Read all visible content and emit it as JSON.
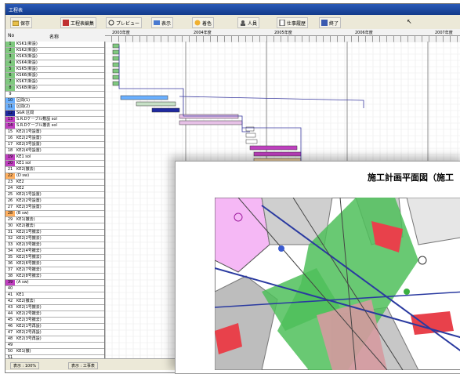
{
  "window": {
    "title": "工程表"
  },
  "toolbar": {
    "buttons": [
      {
        "label": "保存",
        "icon": "folder-icon"
      },
      {
        "label": "工程表編集",
        "icon": "edit-icon"
      },
      {
        "label": "プレビュー",
        "icon": "preview-icon"
      },
      {
        "label": "表示",
        "icon": "view-icon"
      },
      {
        "label": "着色",
        "icon": "paint-icon"
      },
      {
        "label": "人員",
        "icon": "people-icon"
      },
      {
        "label": "仕事履歴",
        "icon": "history-icon"
      },
      {
        "label": "終了",
        "icon": "exit-icon"
      }
    ]
  },
  "header": {
    "no_label": "No",
    "name_label": "名称",
    "years": [
      "2003年度",
      "2004年度",
      "2005年度",
      "2006年度",
      "2007年度"
    ]
  },
  "tasks": [
    {
      "no": "1",
      "name": "KSK1(新設)",
      "color": "#7fc97f"
    },
    {
      "no": "2",
      "name": "KSK2(新設)",
      "color": "#7fc97f"
    },
    {
      "no": "3",
      "name": "KSK3(新設)",
      "color": "#7fc97f"
    },
    {
      "no": "4",
      "name": "KSK4(新設)",
      "color": "#7fc97f"
    },
    {
      "no": "5",
      "name": "KSK5(新設)",
      "color": "#7fc97f"
    },
    {
      "no": "6",
      "name": "KSK6(新設)",
      "color": "#7fc97f"
    },
    {
      "no": "7",
      "name": "KSK7(新設)",
      "color": "#7fc97f"
    },
    {
      "no": "8",
      "name": "KSK8(新設)",
      "color": "#7fc97f"
    },
    {
      "no": "9",
      "name": "",
      "color": "#ffffff"
    },
    {
      "no": "10",
      "name": "区間(1)",
      "color": "#6ab0ff"
    },
    {
      "no": "11",
      "name": "区間(2)",
      "color": "#6ab0ff"
    },
    {
      "no": "12",
      "name": "S&R 区間",
      "color": "#1f2aa0"
    },
    {
      "no": "13",
      "name": "S.R.Dケーブル敷設 sol",
      "color": "#c040c0"
    },
    {
      "no": "14",
      "name": "S.R.Dケーブル撤去 sol",
      "color": "#c040c0"
    },
    {
      "no": "15",
      "name": "KE2(1号設置)",
      "color": "#ffffff"
    },
    {
      "no": "16",
      "name": "KE2(2号設置)",
      "color": "#ffffff"
    },
    {
      "no": "17",
      "name": "KE2(3号設置)",
      "color": "#ffffff"
    },
    {
      "no": "18",
      "name": "KE2(4号設置)",
      "color": "#ffffff"
    },
    {
      "no": "19",
      "name": "KE1 sol",
      "color": "#c040c0"
    },
    {
      "no": "20",
      "name": "KE1 sol",
      "color": "#c040c0"
    },
    {
      "no": "21",
      "name": "KE2(撤去)",
      "color": "#ffffff"
    },
    {
      "no": "22",
      "name": "(D sw)",
      "color": "#ffb060"
    },
    {
      "no": "23",
      "name": "KE2",
      "color": "#ffffff"
    },
    {
      "no": "24",
      "name": "KE2",
      "color": "#ffffff"
    },
    {
      "no": "25",
      "name": "KE2(1号設置)",
      "color": "#ffffff"
    },
    {
      "no": "26",
      "name": "KE2(2号設置)",
      "color": "#ffffff"
    },
    {
      "no": "27",
      "name": "KE2(3号設置)",
      "color": "#ffffff"
    },
    {
      "no": "28",
      "name": "(B sw)",
      "color": "#ffb060"
    },
    {
      "no": "29",
      "name": "KE1(撤去)",
      "color": "#ffffff"
    },
    {
      "no": "30",
      "name": "KE2(撤去)",
      "color": "#ffffff"
    },
    {
      "no": "31",
      "name": "KE2(1号撤去)",
      "color": "#ffffff"
    },
    {
      "no": "32",
      "name": "KE2(2号撤去)",
      "color": "#ffffff"
    },
    {
      "no": "33",
      "name": "KE2(3号撤去)",
      "color": "#ffffff"
    },
    {
      "no": "34",
      "name": "KE2(4号撤去)",
      "color": "#ffffff"
    },
    {
      "no": "35",
      "name": "KE2(5号撤去)",
      "color": "#ffffff"
    },
    {
      "no": "36",
      "name": "KE2(6号撤去)",
      "color": "#ffffff"
    },
    {
      "no": "37",
      "name": "KE2(7号撤去)",
      "color": "#ffffff"
    },
    {
      "no": "38",
      "name": "KE2(8号撤去)",
      "color": "#ffffff"
    },
    {
      "no": "39",
      "name": "(A sw)",
      "color": "#c040c0"
    },
    {
      "no": "40",
      "name": "",
      "color": "#ffffff"
    },
    {
      "no": "41",
      "name": "KE1",
      "color": "#ffffff"
    },
    {
      "no": "42",
      "name": "KE2(撤去)",
      "color": "#ffffff"
    },
    {
      "no": "43",
      "name": "KE2(1号撤去)",
      "color": "#ffffff"
    },
    {
      "no": "44",
      "name": "KE2(2号撤去)",
      "color": "#ffffff"
    },
    {
      "no": "45",
      "name": "KE2(3号撤去)",
      "color": "#ffffff"
    },
    {
      "no": "46",
      "name": "KE2(1号再設)",
      "color": "#ffffff"
    },
    {
      "no": "47",
      "name": "KE2(2号再設)",
      "color": "#ffffff"
    },
    {
      "no": "48",
      "name": "KE2(3号再設)",
      "color": "#ffffff"
    },
    {
      "no": "49",
      "name": "",
      "color": "#ffffff"
    },
    {
      "no": "50",
      "name": "KE1(撤)",
      "color": "#ffffff"
    },
    {
      "no": "51",
      "name": "",
      "color": "#ffffff"
    }
  ],
  "status": {
    "zoom": "表示 : 100%",
    "mode": "表示 : 工事表"
  },
  "document": {
    "title": "施工計画平面図（施工"
  }
}
